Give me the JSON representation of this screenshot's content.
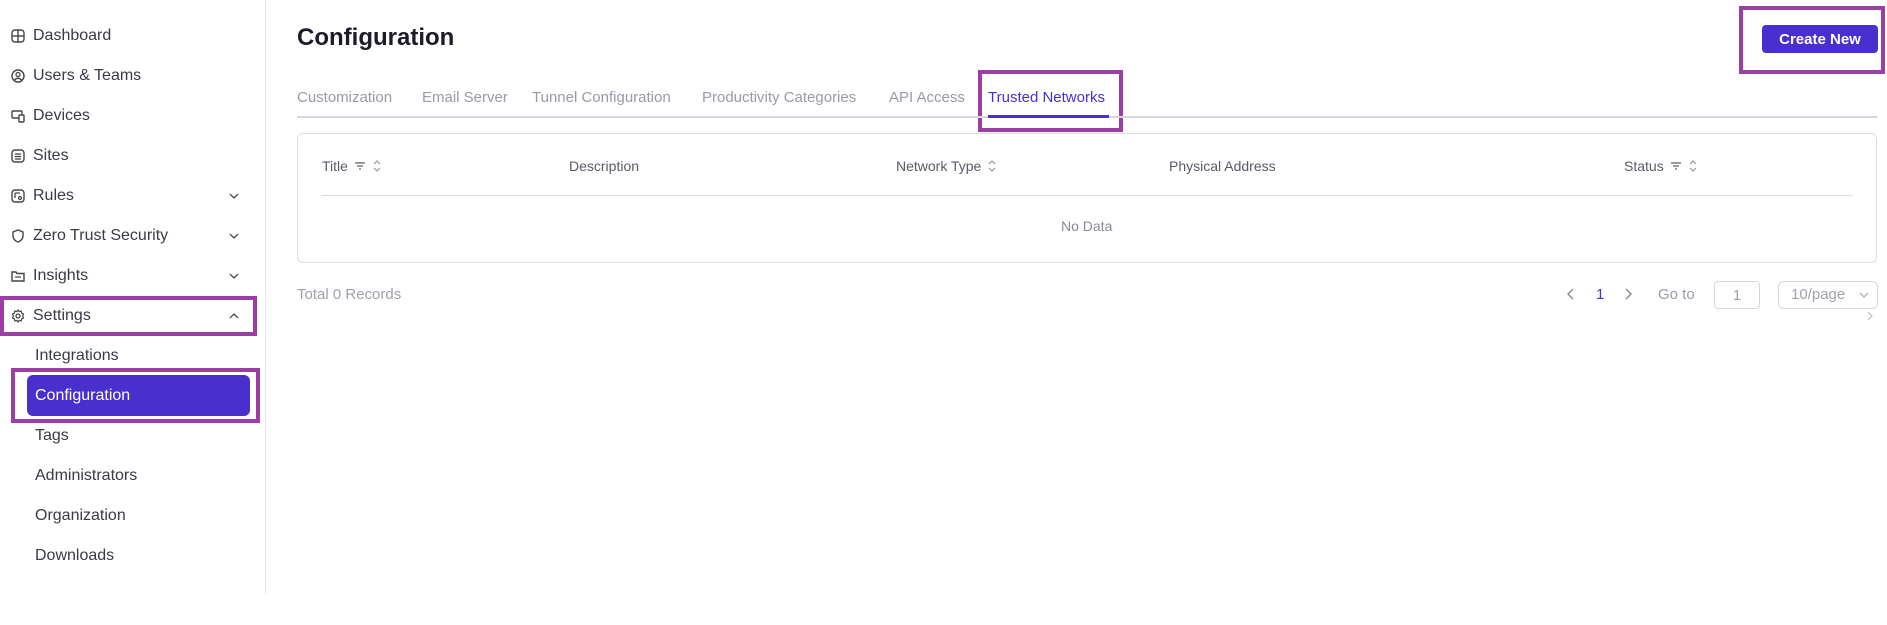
{
  "sidebar": {
    "items": [
      {
        "label": "Dashboard",
        "icon": "dashboard-icon"
      },
      {
        "label": "Users & Teams",
        "icon": "user-circle-icon"
      },
      {
        "label": "Devices",
        "icon": "devices-icon"
      },
      {
        "label": "Sites",
        "icon": "sites-icon"
      },
      {
        "label": "Rules",
        "icon": "rules-icon",
        "expandable": true
      },
      {
        "label": "Zero Trust Security",
        "icon": "shield-icon",
        "expandable": true
      },
      {
        "label": "Insights",
        "icon": "insights-icon",
        "expandable": true
      },
      {
        "label": "Settings",
        "icon": "settings-icon",
        "expanded": true
      }
    ],
    "settings_sub": [
      {
        "label": "Integrations"
      },
      {
        "label": "Configuration",
        "active": true
      },
      {
        "label": "Tags"
      },
      {
        "label": "Administrators"
      },
      {
        "label": "Organization"
      },
      {
        "label": "Downloads"
      }
    ]
  },
  "header": {
    "title": "Configuration",
    "create_label": "Create New"
  },
  "tabs": [
    {
      "label": "Customization"
    },
    {
      "label": "Email Server"
    },
    {
      "label": "Tunnel Configuration"
    },
    {
      "label": "Productivity Categories"
    },
    {
      "label": "API Access"
    },
    {
      "label": "Trusted Networks",
      "active": true
    }
  ],
  "table": {
    "columns": [
      {
        "label": "Title",
        "filter": true,
        "sort": true
      },
      {
        "label": "Description"
      },
      {
        "label": "Network Type",
        "sort": true
      },
      {
        "label": "Physical Address"
      },
      {
        "label": "Status",
        "filter": true,
        "sort": true
      }
    ],
    "empty_text": "No Data"
  },
  "pagination": {
    "total_text": "Total 0  Records",
    "current_page": "1",
    "goto_label": "Go to",
    "goto_value": "1",
    "page_size": "10/page"
  },
  "colors": {
    "accent": "#4a2fcf",
    "highlight": "#9b3fa6"
  }
}
